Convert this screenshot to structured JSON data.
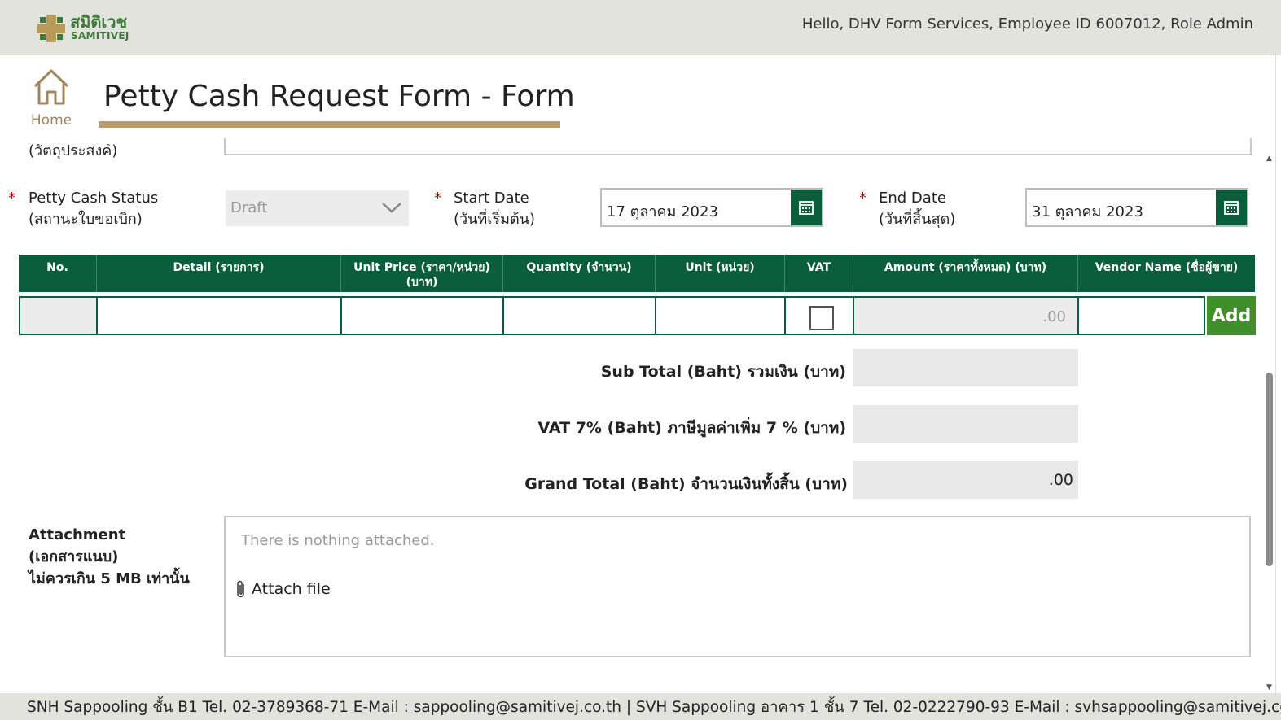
{
  "header": {
    "logo_thai": "สมิติเวช",
    "logo_en": "SAMITIVEJ",
    "greeting": "Hello, DHV Form Services, Employee ID 6007012, Role Admin"
  },
  "nav": {
    "home_label": "Home"
  },
  "page": {
    "title": "Petty Cash Request Form - Form"
  },
  "form": {
    "cut_label": "(วัตถุประสงค์)",
    "status": {
      "label_en": "Petty Cash Status",
      "label_th": "(สถานะใบขอเบิก)",
      "value": "Draft"
    },
    "start_date": {
      "label_en": "Start Date",
      "label_th": "(วันที่เริ่มต้น)",
      "value": "17 ตุลาคม 2023"
    },
    "end_date": {
      "label_en": "End Date",
      "label_th": "(วันที่สิ้นสุด)",
      "value": "31 ตุลาคม 2023"
    },
    "required_mark": "*"
  },
  "table": {
    "columns": [
      "No.",
      "Detail (รายการ)",
      "Unit Price (ราคา/หน่วย) (บาท)",
      "Quantity (จำนวน)",
      "Unit (หน่วย)",
      "VAT",
      "Amount (ราคาทั้งหมด) (บาท)",
      "Vendor Name (ชื่อผู้ขาย)"
    ],
    "new_row": {
      "amount": ".00",
      "vat_checked": false
    },
    "add_label": "Add"
  },
  "totals": {
    "subtotal_label": "Sub Total (Baht) รวมเงิน (บาท)",
    "subtotal_value": "",
    "vat_label": "VAT 7% (Baht) ภาษีมูลค่าเพิ่ม 7 % (บาท)",
    "vat_value": "",
    "grand_label": "Grand Total (Baht) จำนวนเงินทั้งสิ้น (บาท)",
    "grand_value": ".00"
  },
  "attachment": {
    "label_line1": "Attachment",
    "label_line2": "(เอกสารแนบ)",
    "label_line3": "ไม่ควรเกิน 5 MB เท่านั้น",
    "empty_text": "There is nothing attached.",
    "attach_label": "Attach file"
  },
  "footer": {
    "text": "SNH Sappooling ชั้น B1  Tel. 02-3789368-71  E-Mail : sappooling@samitivej.co.th | SVH Sappooling อาคาร 1 ชั้น 7  Tel. 02-0222790-93  E-Mail : svhsappooling@samitivej.co.th"
  },
  "colors": {
    "header_bg": "#e3e3de",
    "brand_green": "#0b5e3c",
    "add_green": "#3f8f2b",
    "gold": "#b89b72",
    "required_red": "#c00000"
  },
  "icons": [
    "home-icon",
    "calendar-icon",
    "chevron-down-icon",
    "paperclip-icon",
    "checkbox-icon"
  ]
}
